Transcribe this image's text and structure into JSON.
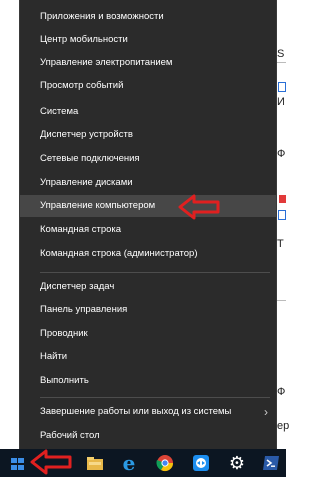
{
  "menu": {
    "items": [
      {
        "label": "Приложения и возможности"
      },
      {
        "label": "Центр мобильности"
      },
      {
        "label": "Управление электропитанием"
      },
      {
        "label": "Просмотр событий"
      },
      {
        "label": "Система"
      },
      {
        "label": "Диспетчер устройств"
      },
      {
        "label": "Сетевые подключения"
      },
      {
        "label": "Управление дисками"
      },
      {
        "label": "Управление компьютером",
        "highlighted": true
      },
      {
        "label": "Командная строка"
      },
      {
        "label": "Командная строка (администратор)"
      },
      {
        "label": "Диспетчер задач"
      },
      {
        "label": "Панель управления"
      },
      {
        "label": "Проводник"
      },
      {
        "label": "Найти"
      },
      {
        "label": "Выполнить"
      },
      {
        "label": "Завершение работы или выход из системы",
        "has_submenu": true
      },
      {
        "label": "Рабочий стол"
      }
    ],
    "submenu_glyph": "›"
  },
  "background_window": {
    "fragments": [
      "S",
      "И",
      "Ф",
      "Т",
      "Ф",
      "ер"
    ]
  },
  "taskbar": {
    "icons": [
      "windows-start-icon",
      "file-explorer-icon",
      "internet-explorer-icon",
      "chrome-icon",
      "teamviewer-icon",
      "settings-gear-icon",
      "powershell-icon"
    ],
    "ie_glyph": "e",
    "gear_glyph": "⚙"
  },
  "colors": {
    "menu_bg": "#2b2b2b",
    "menu_highlight": "#474747",
    "annotation_red": "#e02020",
    "taskbar_bg": "#0c1622"
  }
}
